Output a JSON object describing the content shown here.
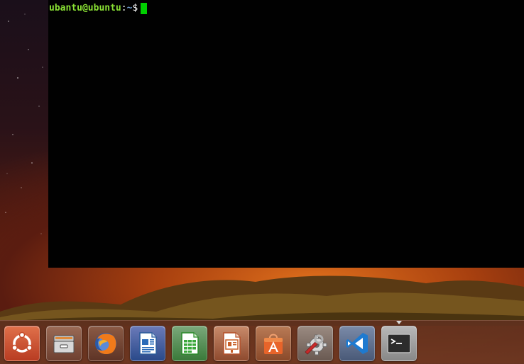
{
  "terminal": {
    "prompt_user_host": "ubantu@ubuntu",
    "prompt_colon": ":",
    "prompt_path": "~",
    "prompt_symbol": "$"
  },
  "launcher": {
    "items": [
      {
        "icon": "ubuntu-dash-icon",
        "color": "#c44a2a"
      },
      {
        "icon": "files-icon",
        "color": "#8a5a46"
      },
      {
        "icon": "firefox-icon",
        "color": "#7a4a38"
      },
      {
        "icon": "libreoffice-writer-icon",
        "color": "#2a5a9a"
      },
      {
        "icon": "libreoffice-calc-icon",
        "color": "#3a8a3a"
      },
      {
        "icon": "libreoffice-impress-icon",
        "color": "#b5502a"
      },
      {
        "icon": "software-center-icon",
        "color": "#e06a2a"
      },
      {
        "icon": "system-settings-icon",
        "color": "#7a7a7a"
      },
      {
        "icon": "vscode-icon",
        "color": "#2a7ac8"
      },
      {
        "icon": "terminal-icon",
        "color": "#3a3a3a"
      }
    ]
  }
}
